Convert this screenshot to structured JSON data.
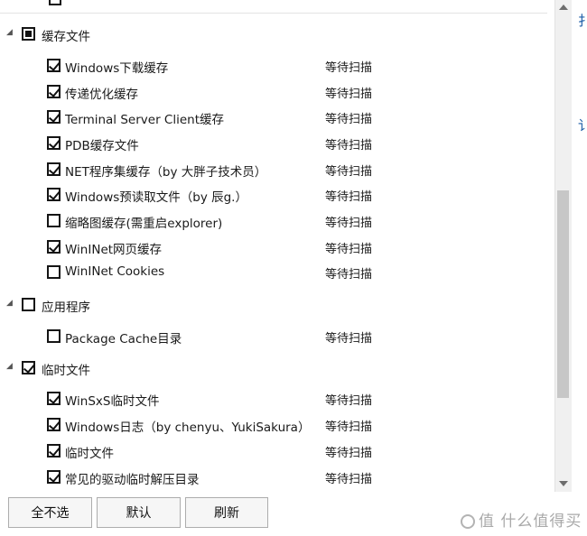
{
  "tree": {
    "groups": [
      {
        "label": "缓存文件",
        "state": "partial",
        "items": [
          {
            "label": "Windows下载缓存",
            "checked": true,
            "status": "等待扫描"
          },
          {
            "label": "传递优化缓存",
            "checked": true,
            "status": "等待扫描"
          },
          {
            "label": "Terminal Server Client缓存",
            "checked": true,
            "status": "等待扫描"
          },
          {
            "label": "PDB缓存文件",
            "checked": true,
            "status": "等待扫描"
          },
          {
            "label": "NET程序集缓存（by 大胖子技术员）",
            "checked": true,
            "status": "等待扫描"
          },
          {
            "label": "Windows预读取文件（by 辰g.）",
            "checked": true,
            "status": "等待扫描"
          },
          {
            "label": "缩略图缓存(需重启explorer)",
            "checked": false,
            "status": "等待扫描"
          },
          {
            "label": "WinINet网页缓存",
            "checked": true,
            "status": "等待扫描"
          },
          {
            "label": "WinINet Cookies",
            "checked": false,
            "status": "等待扫描"
          }
        ]
      },
      {
        "label": "应用程序",
        "state": "unchecked",
        "items": [
          {
            "label": "Package Cache目录",
            "checked": false,
            "status": "等待扫描"
          }
        ]
      },
      {
        "label": "临时文件",
        "state": "checked",
        "items": [
          {
            "label": "WinSxS临时文件",
            "checked": true,
            "status": "等待扫描"
          },
          {
            "label": "Windows日志（by chenyu、YukiSakura）",
            "checked": true,
            "status": "等待扫描"
          },
          {
            "label": "临时文件",
            "checked": true,
            "status": "等待扫描"
          },
          {
            "label": "常见的驱动临时解压目录",
            "checked": true,
            "status": "等待扫描"
          }
        ]
      }
    ]
  },
  "buttons": {
    "deselect_all": "全不选",
    "default": "默认",
    "refresh": "刷新"
  },
  "side_panel": {
    "glyph_top": "扌",
    "glyph_mid": "讠"
  },
  "watermark": {
    "text": "值 什么值得买"
  },
  "colors": {
    "side_text": "#1f5fa8",
    "scroll_thumb": "#c7c7c7"
  }
}
